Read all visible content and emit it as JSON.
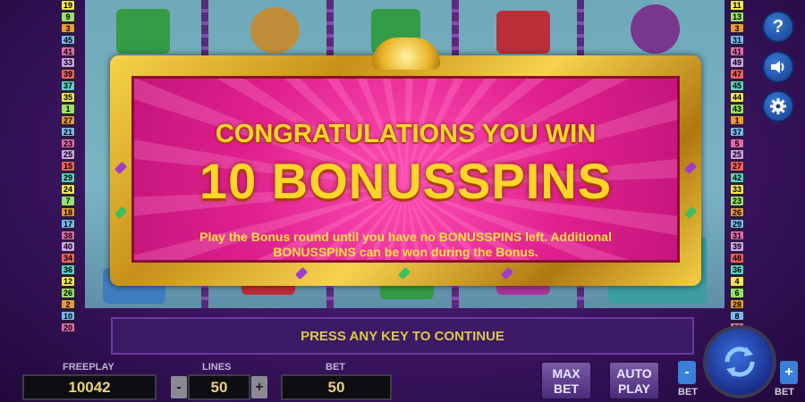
{
  "popup": {
    "headline": "CONGRATULATIONS YOU WIN",
    "award": "10 BONUSSPINS",
    "description": "Play the Bonus round until you have no BONUSSPINS left. Additional BONUSSPINS can be won during the Bonus."
  },
  "lines_left": [
    "19",
    "9",
    "3",
    "45",
    "41",
    "33",
    "39",
    "37",
    "35",
    "1",
    "27",
    "21",
    "23",
    "25",
    "15",
    "29",
    "24",
    "7",
    "18",
    "17",
    "38",
    "40",
    "34",
    "36",
    "12",
    "26",
    "2",
    "10",
    "20"
  ],
  "lines_right": [
    "11",
    "13",
    "3",
    "31",
    "41",
    "49",
    "47",
    "45",
    "44",
    "43",
    "1",
    "37",
    "5",
    "25",
    "27",
    "42",
    "33",
    "23",
    "26",
    "29",
    "31",
    "39",
    "48",
    "36",
    "4",
    "6",
    "28",
    "8",
    "12"
  ],
  "side_buttons": {
    "help_label": "?",
    "sound_icon": "speaker-icon",
    "settings_icon": "gear-icon"
  },
  "bottom": {
    "continue_label": "PRESS ANY KEY TO CONTINUE",
    "freeplay_label": "FREEPLAY",
    "freeplay_value": "10042",
    "lines_label": "LINES",
    "lines_value": "50",
    "lines_minus": "-",
    "lines_plus": "+",
    "bet_label": "BET",
    "bet_value": "50",
    "max_bet_line1": "MAX",
    "max_bet_line2": "BET",
    "auto_play_line1": "AUTO",
    "auto_play_line2": "PLAY",
    "bet_minus": "-",
    "bet_plus": "+",
    "bet_minus_label": "BET",
    "bet_plus_label": "BET",
    "spin_icon": "refresh-arrows-icon"
  },
  "colors": {
    "gold": "#ffd52a",
    "popup_pink": "#e0208e",
    "panel_purple": "#3b1a66"
  }
}
